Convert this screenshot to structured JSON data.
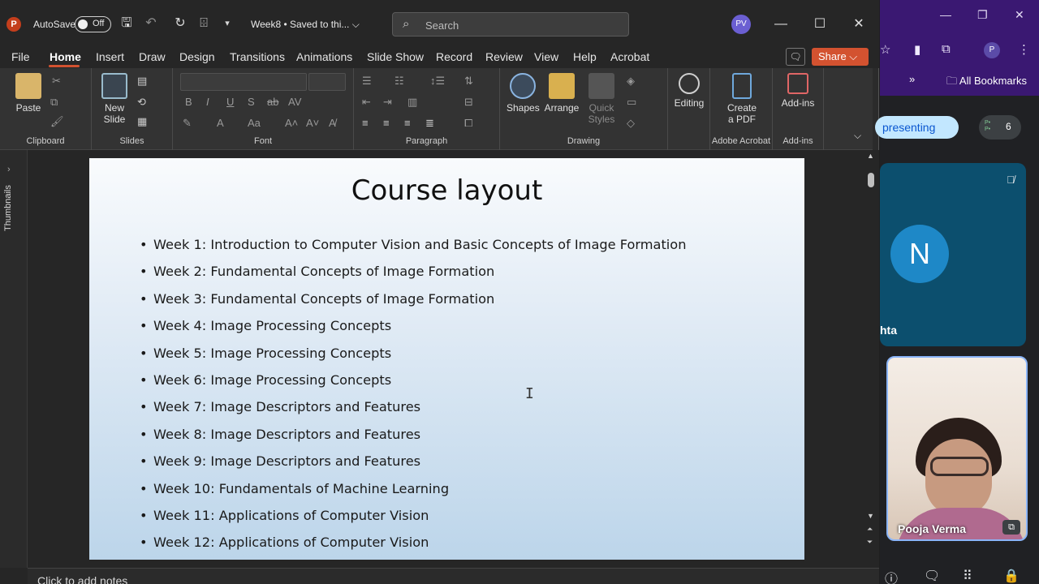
{
  "titlebar": {
    "app_logo": "P",
    "autosave_label": "AutoSave",
    "autosave_state": "Off",
    "doc_title": "Week8 • Saved to thi... ⌵",
    "search_placeholder": "Search",
    "user_initials": "PV"
  },
  "menu": {
    "tabs": [
      "File",
      "Home",
      "Insert",
      "Draw",
      "Design",
      "Transitions",
      "Animations",
      "Slide Show",
      "Record",
      "Review",
      "View",
      "Help",
      "Acrobat"
    ],
    "active_tab": "Home",
    "share_label": "Share ⌵"
  },
  "ribbon": {
    "clipboard": {
      "paste": "Paste",
      "label": "Clipboard"
    },
    "slides": {
      "new_slide": "New Slide",
      "label": "Slides"
    },
    "font": {
      "label": "Font"
    },
    "paragraph": {
      "label": "Paragraph"
    },
    "drawing": {
      "shapes": "Shapes",
      "arrange": "Arrange",
      "quick_styles": "Quick Styles",
      "label": "Drawing"
    },
    "editing": {
      "label": "Editing"
    },
    "adobe": {
      "create_pdf": "Create a PDF",
      "label": "Adobe Acrobat"
    },
    "addins": {
      "button": "Add-ins",
      "label": "Add-ins"
    }
  },
  "thumbnails_label": "Thumbnails",
  "slide": {
    "title": "Course layout",
    "bullets": [
      "Week 1: Introduction to Computer Vision and Basic Concepts of Image Formation",
      "Week 2: Fundamental Concepts of Image Formation",
      "Week 3: Fundamental Concepts of Image Formation",
      "Week 4: Image Processing Concepts",
      "Week 5: Image Processing Concepts",
      "Week 6: Image Processing Concepts",
      "Week 7: Image Descriptors and Features",
      "Week 8: Image Descriptors and Features",
      "Week 9: Image Descriptors and Features",
      "Week 10: Fundamentals of Machine Learning",
      "Week 11: Applications of Computer Vision",
      "Week 12: Applications of Computer Vision"
    ]
  },
  "notes_placeholder": "Click to add notes",
  "browser": {
    "bookmarks": "All Bookmarks",
    "profile_initial": "P"
  },
  "meet": {
    "presenting_label": "presenting",
    "participant_count": "6",
    "tile_n_initial": "N",
    "tile_n_name": "hta",
    "tile_pv_name": "Pooja Verma"
  }
}
